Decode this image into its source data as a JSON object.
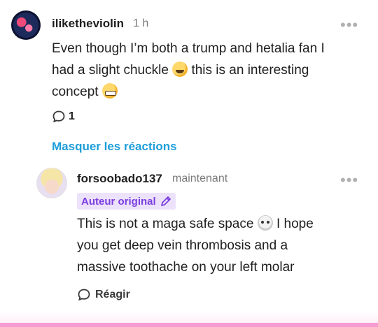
{
  "comment": {
    "username": "iliketheviolin",
    "time": "1 h",
    "text_1": "Even though I’m both a trump and hetalia fan I",
    "text_2a": "had a slight chuckle",
    "text_2b": "this is an interesting",
    "text_3": "concept",
    "reply_count": "1",
    "hide_replies_label": "Masquer les réactions",
    "emoji_1": "rolling-on-floor-laughing-emoji",
    "emoji_2": "grinning-face-emoji"
  },
  "reply": {
    "username": "forsoobado137",
    "time": "maintenant",
    "badge_label": "Auteur original",
    "text_1a": "This is not a maga safe space",
    "text_1b": "I hope",
    "text_2": "you get deep vein thrombosis and a",
    "text_3": "massive toothache on your left molar",
    "react_label": "Réagir",
    "emoji": "skull-emoji"
  },
  "colors": {
    "link": "#1d9ed9",
    "badge_bg": "#ede2fb",
    "badge_text": "#7b3fe0",
    "accent_bar": "#f79bd3"
  }
}
